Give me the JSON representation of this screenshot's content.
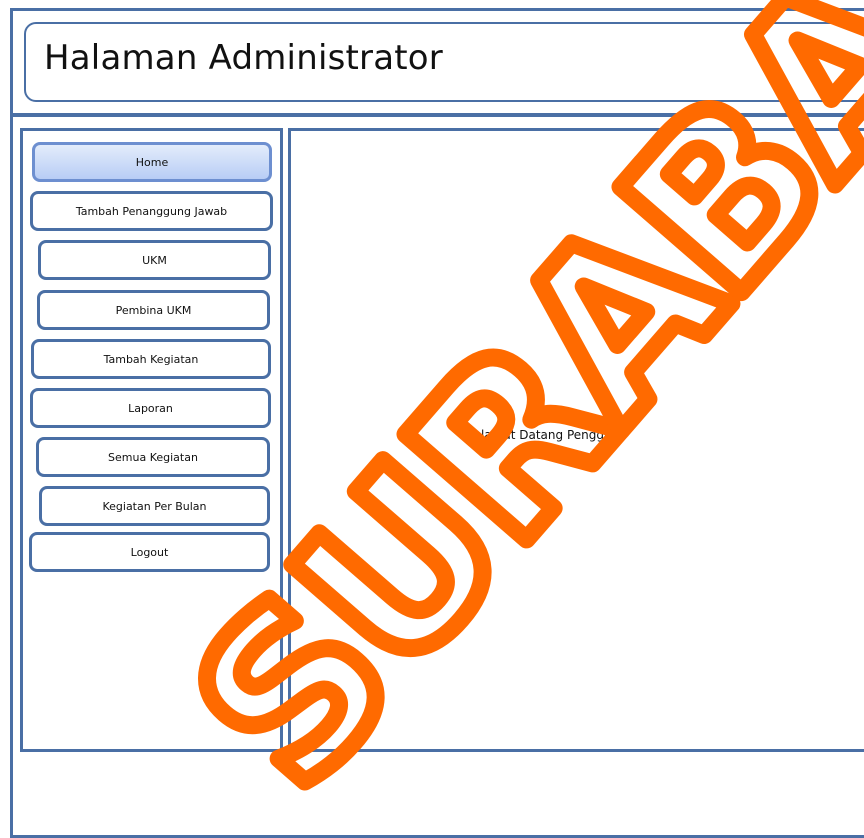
{
  "header": {
    "title": "Halaman Administrator"
  },
  "sidebar": {
    "items": [
      {
        "label": "Home",
        "active": true
      },
      {
        "label": "Tambah Penanggung Jawab"
      },
      {
        "label": "UKM"
      },
      {
        "label": "Pembina UKM"
      },
      {
        "label": "Tambah Kegiatan"
      },
      {
        "label": "Laporan"
      },
      {
        "label": "Semua Kegiatan"
      },
      {
        "label": "Kegiatan Per Bulan"
      },
      {
        "label": "Logout"
      }
    ]
  },
  "main": {
    "welcome_text": "Selamat Datang Pengguna"
  },
  "watermark": {
    "text": "SURABAYA",
    "color": "#ff6a00"
  },
  "colors": {
    "border": "#4a6fa5",
    "active_button": "#b8cdf5"
  }
}
